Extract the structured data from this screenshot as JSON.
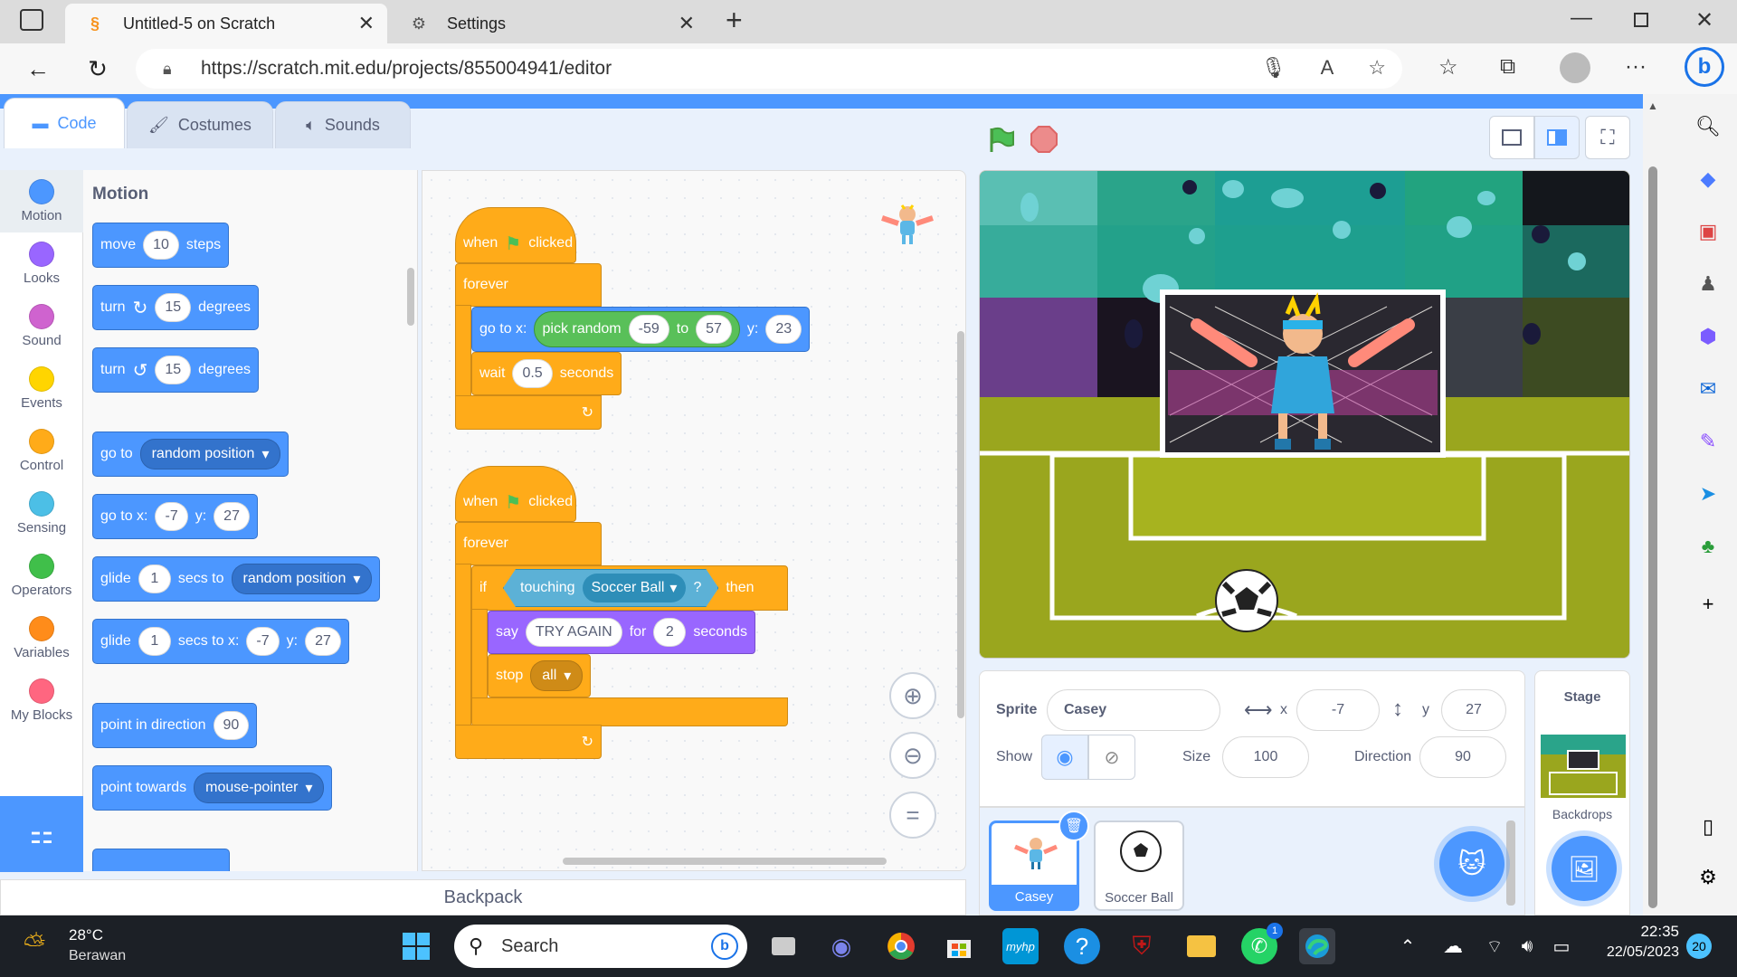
{
  "browser": {
    "tabs": [
      {
        "title": "Untitled-5 on Scratch",
        "active": true
      },
      {
        "title": "Settings",
        "active": false
      }
    ],
    "url": "https://scratch.mit.edu/projects/855004941/editor"
  },
  "scratch": {
    "editor_tabs": [
      "Code",
      "Costumes",
      "Sounds"
    ],
    "categories": [
      {
        "label": "Motion",
        "color": "#4c97ff"
      },
      {
        "label": "Looks",
        "color": "#9966ff"
      },
      {
        "label": "Sound",
        "color": "#cf63cf"
      },
      {
        "label": "Events",
        "color": "#ffd500"
      },
      {
        "label": "Control",
        "color": "#ffab19"
      },
      {
        "label": "Sensing",
        "color": "#4cbfe6"
      },
      {
        "label": "Operators",
        "color": "#40bf4a"
      },
      {
        "label": "Variables",
        "color": "#ff8c1a"
      },
      {
        "label": "My Blocks",
        "color": "#ff6680"
      }
    ],
    "palette": {
      "title": "Motion",
      "move": {
        "a": "move",
        "v": "10",
        "b": "steps"
      },
      "turn_right": {
        "a": "turn",
        "v": "15",
        "b": "degrees"
      },
      "turn_left": {
        "a": "turn",
        "v": "15",
        "b": "degrees"
      },
      "goto": {
        "a": "go to",
        "opt": "random position"
      },
      "goto_xy": {
        "a": "go to x:",
        "x": "-7",
        "b": "y:",
        "y": "27"
      },
      "glide": {
        "a": "glide",
        "v": "1",
        "b": "secs to",
        "opt": "random position"
      },
      "glide_xy": {
        "a": "glide",
        "v": "1",
        "b": "secs to x:",
        "x": "-7",
        "c": "y:",
        "y": "27"
      },
      "point_dir": {
        "a": "point in direction",
        "v": "90"
      },
      "point_towards": {
        "a": "point towards",
        "opt": "mouse-pointer"
      }
    },
    "script1": {
      "when": "when",
      "clicked": "clicked",
      "forever": "forever",
      "goto": "go to x:",
      "pick": "pick random",
      "from": "-59",
      "to_label": "to",
      "to": "57",
      "y_label": "y:",
      "y": "23",
      "wait": "wait",
      "wait_v": "0.5",
      "seconds": "seconds"
    },
    "script2": {
      "when": "when",
      "clicked": "clicked",
      "forever": "forever",
      "if": "if",
      "touching": "touching",
      "object": "Soccer Ball",
      "q": "?",
      "then": "then",
      "say": "say",
      "msg": "TRY AGAIN",
      "for": "for",
      "secs": "2",
      "seconds": "seconds",
      "stop": "stop",
      "stop_opt": "all"
    },
    "backpack": "Backpack",
    "sprite_info": {
      "sprite_label": "Sprite",
      "sprite_name": "Casey",
      "x_label": "x",
      "x": "-7",
      "y_label": "y",
      "y": "27",
      "show_label": "Show",
      "size_label": "Size",
      "size": "100",
      "direction_label": "Direction",
      "direction": "90"
    },
    "sprites": [
      "Casey",
      "Soccer Ball"
    ],
    "stage_pane": {
      "title": "Stage",
      "backdrops": "Backdrops"
    }
  },
  "taskbar": {
    "weather_temp": "28°C",
    "weather_desc": "Berawan",
    "search_placeholder": "Search",
    "time": "22:35",
    "date": "22/05/2023",
    "notif_count": "20",
    "whatsapp_badge": "1"
  }
}
